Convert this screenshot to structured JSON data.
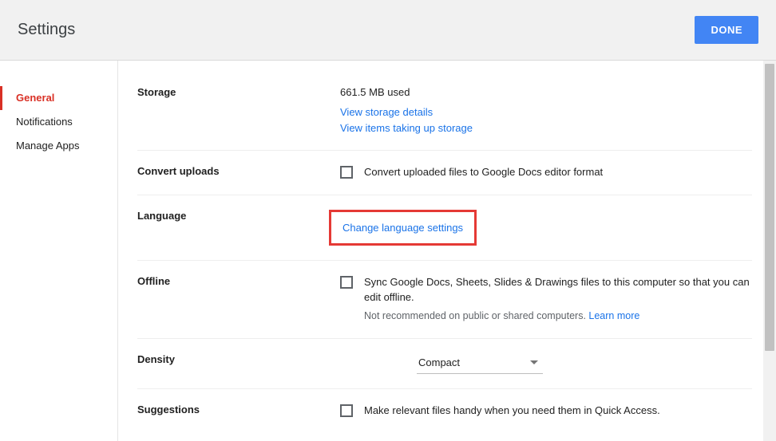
{
  "header": {
    "title": "Settings",
    "done_label": "DONE"
  },
  "sidebar": {
    "items": [
      {
        "label": "General",
        "active": true
      },
      {
        "label": "Notifications",
        "active": false
      },
      {
        "label": "Manage Apps",
        "active": false
      }
    ]
  },
  "sections": {
    "storage": {
      "label": "Storage",
      "used_text": "661.5 MB used",
      "link1": "View storage details",
      "link2": "View items taking up storage"
    },
    "convert": {
      "label": "Convert uploads",
      "checkbox_text": "Convert uploaded files to Google Docs editor format"
    },
    "language": {
      "label": "Language",
      "link": "Change language settings"
    },
    "offline": {
      "label": "Offline",
      "checkbox_text": "Sync Google Docs, Sheets, Slides & Drawings files to this computer so that you can edit offline.",
      "note_prefix": "Not recommended on public or shared computers. ",
      "learn_more": "Learn more"
    },
    "density": {
      "label": "Density",
      "value": "Compact"
    },
    "suggestions": {
      "label": "Suggestions",
      "checkbox_text": "Make relevant files handy when you need them in Quick Access."
    }
  }
}
